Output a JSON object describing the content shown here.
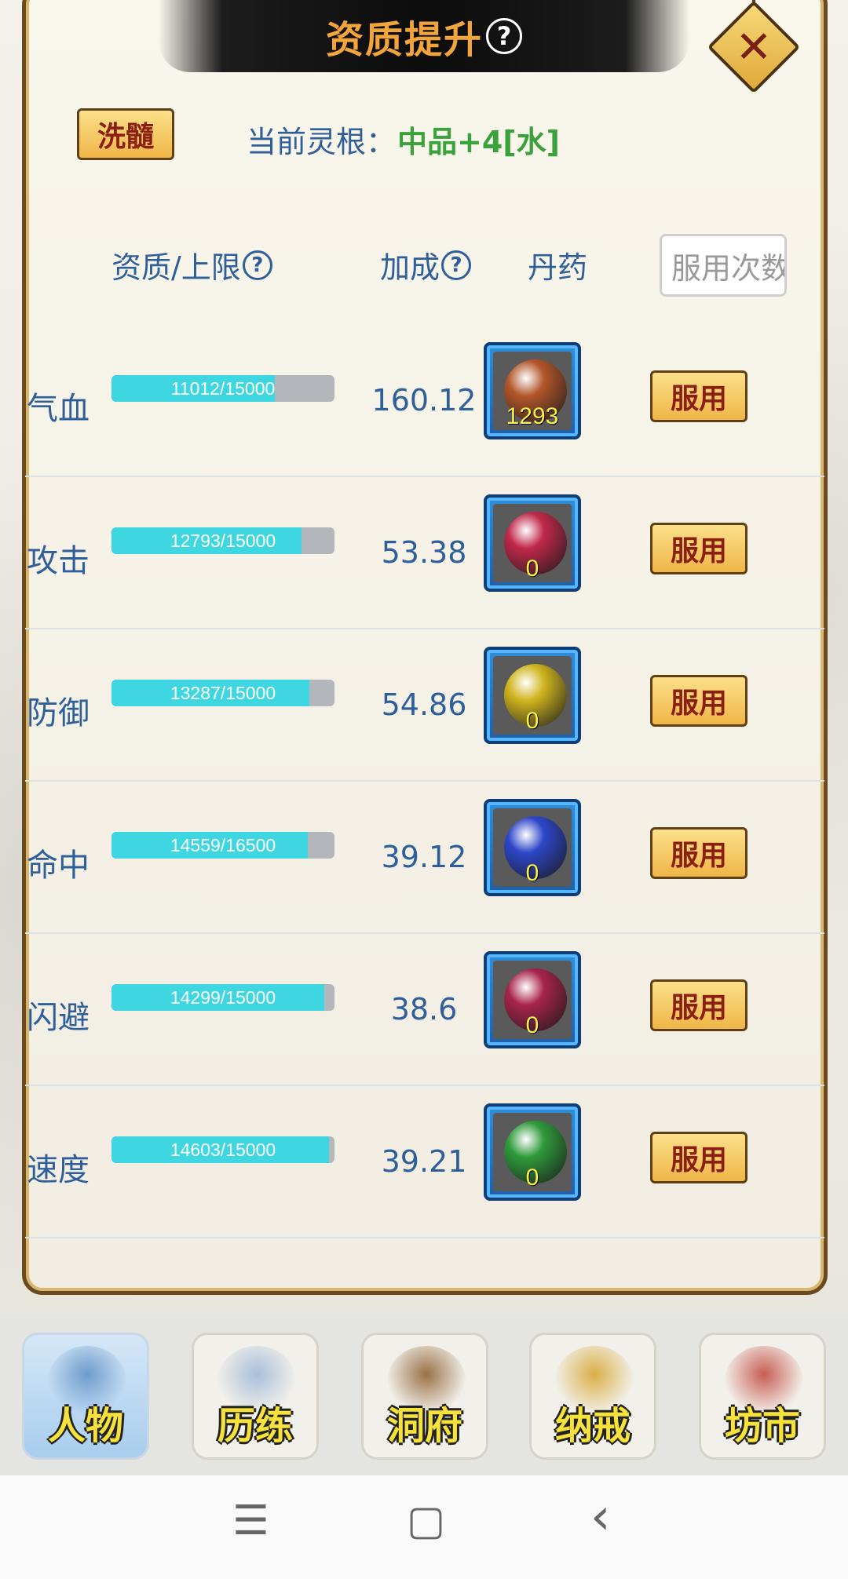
{
  "header": {
    "title": "资质提升",
    "title_help": "?",
    "close": "✕"
  },
  "top": {
    "wash_label": "洗髓",
    "root_label": "当前灵根：",
    "root_value": "中品+4[水]"
  },
  "columns": {
    "aptitude": "资质/上限",
    "aptitude_help": "?",
    "bonus": "加成",
    "bonus_help": "?",
    "pill": "丹药",
    "count_placeholder": "服用次数"
  },
  "stats": [
    {
      "name": "气血",
      "progress": "11012/15000",
      "fill": 0.734,
      "bonus": "160.12",
      "pill_count": "1293",
      "pill_color": "#b3562a",
      "use_label": "服用"
    },
    {
      "name": "攻击",
      "progress": "12793/15000",
      "fill": 0.853,
      "bonus": "53.38",
      "pill_count": "0",
      "pill_color": "#c0284a",
      "use_label": "服用"
    },
    {
      "name": "防御",
      "progress": "13287/15000",
      "fill": 0.886,
      "bonus": "54.86",
      "pill_count": "0",
      "pill_color": "#d0b51f",
      "use_label": "服用"
    },
    {
      "name": "命中",
      "progress": "14559/16500",
      "fill": 0.882,
      "bonus": "39.12",
      "pill_count": "0",
      "pill_color": "#2d46c9",
      "use_label": "服用"
    },
    {
      "name": "闪避",
      "progress": "14299/15000",
      "fill": 0.953,
      "bonus": "38.6",
      "pill_count": "0",
      "pill_color": "#a8234d",
      "use_label": "服用"
    },
    {
      "name": "速度",
      "progress": "14603/15000",
      "fill": 0.974,
      "bonus": "39.21",
      "pill_count": "0",
      "pill_color": "#2f9a3a",
      "use_label": "服用"
    }
  ],
  "nav": [
    {
      "label": "人物",
      "icon": "character-icon",
      "active": true,
      "art_color": "#5f8fc4"
    },
    {
      "label": "历练",
      "icon": "swords-icon",
      "active": false,
      "art_color": "#9bb6d6"
    },
    {
      "label": "洞府",
      "icon": "cave-house-icon",
      "active": false,
      "art_color": "#8a5a2a"
    },
    {
      "label": "纳戒",
      "icon": "ring-icon",
      "active": false,
      "art_color": "#d6a32a"
    },
    {
      "label": "坊市",
      "icon": "market-pagoda-icon",
      "active": false,
      "art_color": "#c0443a"
    }
  ],
  "system_bar": {
    "menu": "☰",
    "home": "▢",
    "back": "‹"
  },
  "colors": {
    "accent_blue": "#2e5f9a",
    "green_value": "#3aa23b",
    "bar_fill": "#3ed6e0",
    "button_text": "#8b1f12"
  }
}
